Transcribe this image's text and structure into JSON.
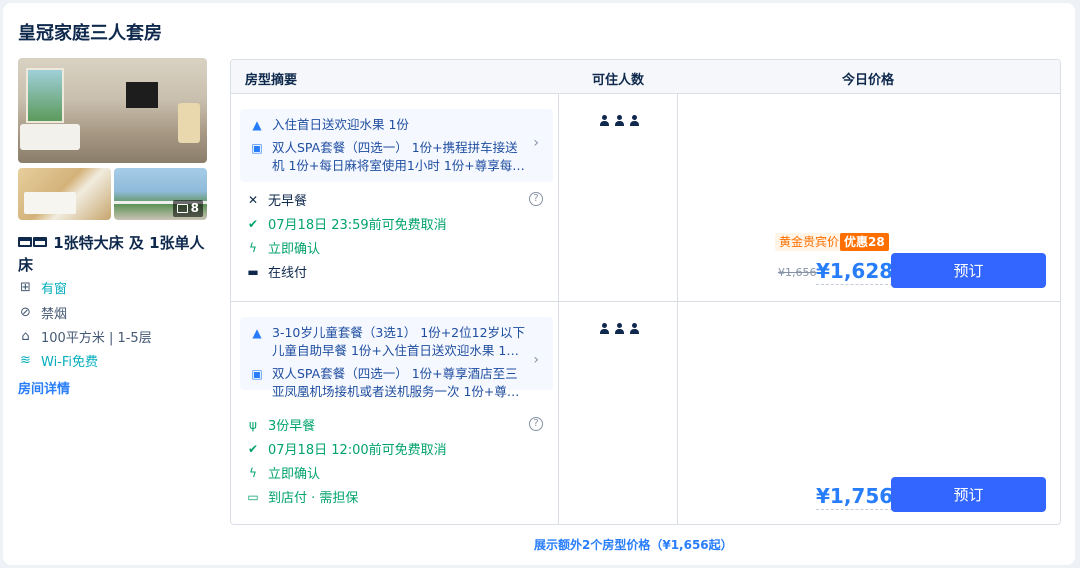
{
  "room": {
    "title": "皇冠家庭三人套房",
    "photo_count": "8",
    "bed": "1张特大床 及 1张单人床",
    "features": [
      {
        "icon": "window-icon",
        "label": "有窗"
      },
      {
        "icon": "no-smoking-icon",
        "label": "禁烟"
      },
      {
        "icon": "area-icon",
        "label": "100平方米 | 1-5层"
      },
      {
        "icon": "wifi-icon",
        "label": "Wi-Fi免费"
      }
    ],
    "details_link": "房间详情"
  },
  "table": {
    "headers": {
      "summary": "房型摘要",
      "occupancy": "可住人数",
      "price": "今日价格"
    },
    "offers": [
      {
        "packages": [
          {
            "icon": "dome-icon",
            "text": "入住首日送欢迎水果 1份"
          },
          {
            "icon": "gift-icon",
            "text": "双人SPA套餐（四选一） 1份+携程拼车接送机 1份+每日麻将室使用1小时 1份+尊享每…"
          }
        ],
        "meal": "无早餐",
        "cancel": "07月18日 23:59前可免费取消",
        "confirm": "立即确认",
        "payment": "在线付",
        "gold_tag": "黄金贵宾价",
        "discount_tag": "优惠28",
        "old_price": "¥1,656",
        "price": "¥1,628",
        "button": "预订"
      },
      {
        "packages": [
          {
            "icon": "dome-icon",
            "text": "3-10岁儿童套餐（3选1） 1份+2位12岁以下儿童自助早餐 1份+入住首日送欢迎水果 1…"
          },
          {
            "icon": "gift-icon",
            "text": "双人SPA套餐（四选一） 1份+尊享酒店至三亚凤凰机场接机或者送机服务一次 1份+尊…"
          }
        ],
        "meal": "3份早餐",
        "cancel": "07月18日 12:00前可免费取消",
        "confirm": "立即确认",
        "payment": "到店付 · 需担保",
        "price": "¥1,756",
        "button": "预订"
      }
    ]
  },
  "more_prices": "展示额外2个房型价格（¥1,656起）",
  "colors": {
    "accent": "#287dfa",
    "button": "#3366ff",
    "green": "#00a36b",
    "orange": "#ff6f00"
  }
}
